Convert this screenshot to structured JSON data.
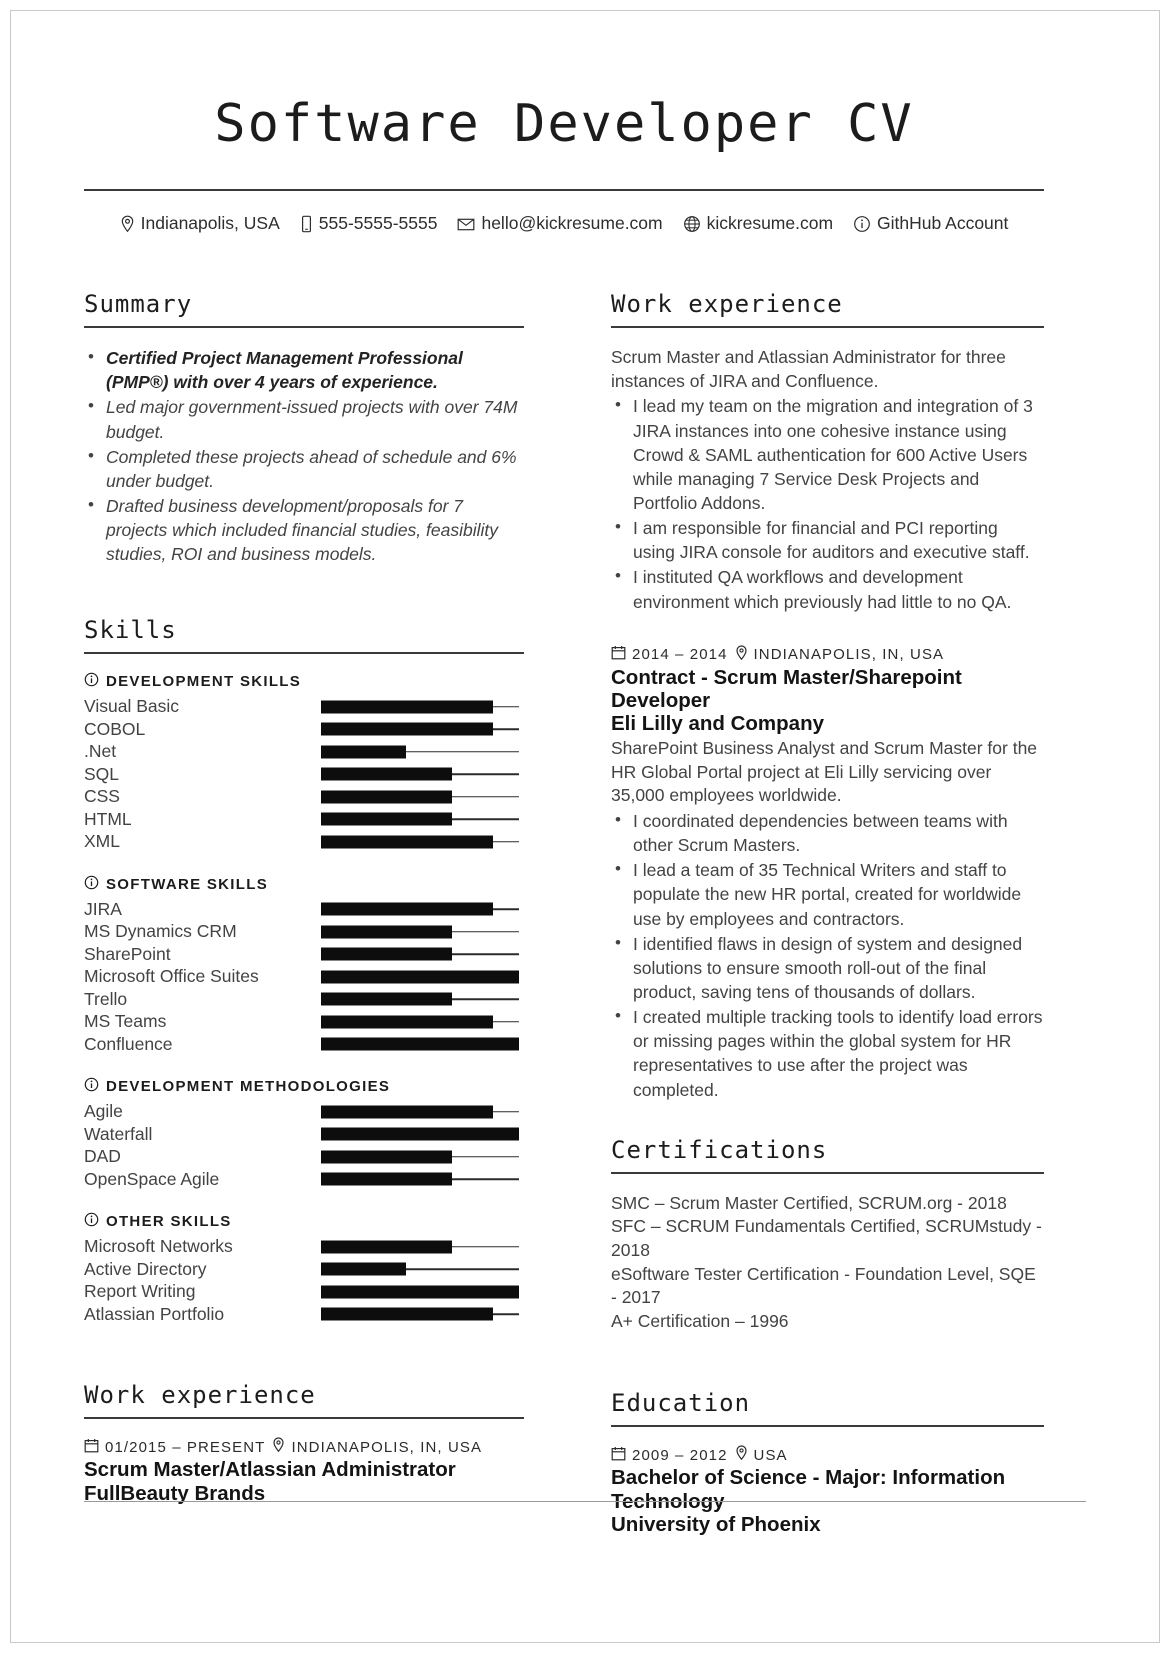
{
  "header": {
    "title": "Software Developer CV",
    "contacts": [
      {
        "icon": "location-pin-icon",
        "text": "Indianapolis, USA"
      },
      {
        "icon": "phone-icon",
        "text": "555-5555-5555"
      },
      {
        "icon": "envelope-icon",
        "text": "hello@kickresume.com"
      },
      {
        "icon": "globe-icon",
        "text": "kickresume.com"
      },
      {
        "icon": "info-circle-icon",
        "text": "GithHub Account"
      }
    ]
  },
  "left": {
    "summary": {
      "heading": "Summary",
      "items": [
        "Certified Project Management Professional (PMP®) with over 4 years of experience.",
        "Led major government-issued projects with over 74M budget.",
        "Completed these projects ahead of schedule and 6% under budget.",
        "Drafted business development/proposals for 7 projects which included financial studies, feasibility studies, ROI and business models."
      ]
    },
    "skills": {
      "heading": "Skills",
      "groups": [
        {
          "title": "DEVELOPMENT SKILLS",
          "items": [
            {
              "name": "Visual Basic",
              "level": 87
            },
            {
              "name": "COBOL",
              "level": 87
            },
            {
              "name": ".Net",
              "level": 43
            },
            {
              "name": "SQL",
              "level": 66
            },
            {
              "name": "CSS",
              "level": 66
            },
            {
              "name": "HTML",
              "level": 66
            },
            {
              "name": "XML",
              "level": 87
            }
          ]
        },
        {
          "title": "SOFTWARE SKILLS",
          "items": [
            {
              "name": "JIRA",
              "level": 87
            },
            {
              "name": "MS Dynamics CRM",
              "level": 66
            },
            {
              "name": "SharePoint",
              "level": 66
            },
            {
              "name": "Microsoft Office Suites",
              "level": 100
            },
            {
              "name": "Trello",
              "level": 66
            },
            {
              "name": "MS Teams",
              "level": 87
            },
            {
              "name": "Confluence",
              "level": 100
            }
          ]
        },
        {
          "title": "DEVELOPMENT METHODOLOGIES",
          "items": [
            {
              "name": "Agile",
              "level": 87
            },
            {
              "name": "Waterfall",
              "level": 100
            },
            {
              "name": "DAD",
              "level": 66
            },
            {
              "name": "OpenSpace Agile",
              "level": 66
            }
          ]
        },
        {
          "title": "OTHER SKILLS",
          "items": [
            {
              "name": "Microsoft Networks",
              "level": 66
            },
            {
              "name": "Active Directory",
              "level": 43
            },
            {
              "name": "Report Writing",
              "level": 100
            },
            {
              "name": "Atlassian Portfolio",
              "level": 87
            }
          ]
        }
      ]
    },
    "work": {
      "heading": "Work experience",
      "date": "01/2015 – PRESENT",
      "location": "INDIANAPOLIS, IN, USA",
      "title": "Scrum Master/Atlassian Administrator",
      "company": "FullBeauty Brands"
    }
  },
  "right": {
    "work": {
      "heading": "Work experience",
      "intro": "Scrum Master and Atlassian Administrator for three instances of JIRA and Confluence.",
      "bullets": [
        "I lead my team on the migration and integration of 3 JIRA instances into one cohesive instance using Crowd & SAML authentication for 600 Active Users while managing 7 Service Desk Projects and Portfolio Addons.",
        "I am responsible for financial and PCI reporting using JIRA console for auditors and executive staff.",
        "I instituted QA workflows and development environment which previously had little to no QA."
      ],
      "job": {
        "date": "2014 – 2014",
        "location": "INDIANAPOLIS, IN, USA",
        "title": "Contract - Scrum Master/Sharepoint Developer",
        "company": "Eli Lilly and Company",
        "intro": "SharePoint Business Analyst and Scrum Master for the HR Global Portal project at Eli Lilly servicing over 35,000 employees worldwide.",
        "bullets": [
          "I coordinated dependencies between teams with other Scrum Masters.",
          "I lead a team of 35 Technical Writers and staff to populate the new HR portal, created for worldwide use by employees and contractors.",
          "I identified flaws in design of system and designed solutions to ensure smooth roll-out of the final product, saving tens of thousands of dollars.",
          "I created multiple tracking tools to identify load errors or missing pages within the global system for HR representatives to use after the project was completed."
        ]
      }
    },
    "certifications": {
      "heading": "Certifications",
      "lines": [
        "SMC – Scrum Master Certified, SCRUM.org - 2018",
        "SFC – SCRUM Fundamentals Certified, SCRUMstudy - 2018",
        "eSoftware Tester Certification - Foundation Level, SQE - 2017",
        "A+ Certification – 1996"
      ]
    },
    "education": {
      "heading": "Education",
      "date": "2009 – 2012",
      "location": "USA",
      "degree": "Bachelor of Science - Major: Information Technology",
      "school": "University of Phoenix"
    }
  }
}
